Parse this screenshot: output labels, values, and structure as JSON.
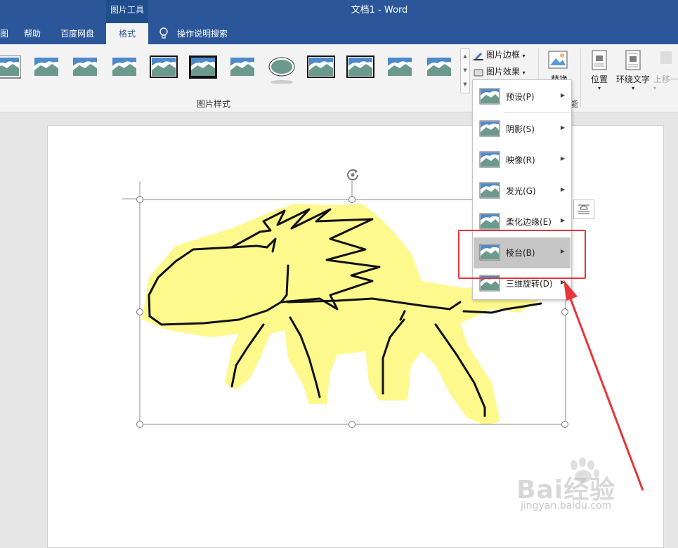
{
  "window": {
    "title": "文档1  -  Word",
    "context_tab": "图片工具"
  },
  "tabs": [
    {
      "label": "图"
    },
    {
      "label": "帮助"
    },
    {
      "label": "百度网盘"
    },
    {
      "label": "格式"
    }
  ],
  "tell_me": {
    "label": "操作说明搜索"
  },
  "ribbon": {
    "styles_group_label": "图片样式",
    "picture_border_label": "图片边框",
    "picture_effects_label": "图片效果",
    "replace_label": "替换",
    "position_label": "位置",
    "wrap_text_label": "环绕文字",
    "bring_forward_label": "上移一",
    "partial_group_label": "能"
  },
  "effects_menu": {
    "items": [
      {
        "label": "预设(P)",
        "underline": "P"
      },
      {
        "label": "阴影(S)",
        "underline": "S"
      },
      {
        "label": "映像(R)",
        "underline": "R"
      },
      {
        "label": "发光(G)",
        "underline": "G"
      },
      {
        "label": "柔化边缘(E)",
        "underline": "E"
      },
      {
        "label": "棱台(B)",
        "underline": "B",
        "active": true
      },
      {
        "label": "三维旋转(D)",
        "underline": "D"
      }
    ]
  },
  "watermark": {
    "text": "Bai经验",
    "url": "jingyan.baidu.com"
  },
  "colors": {
    "accent": "#2b579a",
    "highlight": "#e8343a",
    "drawing_fill": "#fdf98d"
  }
}
